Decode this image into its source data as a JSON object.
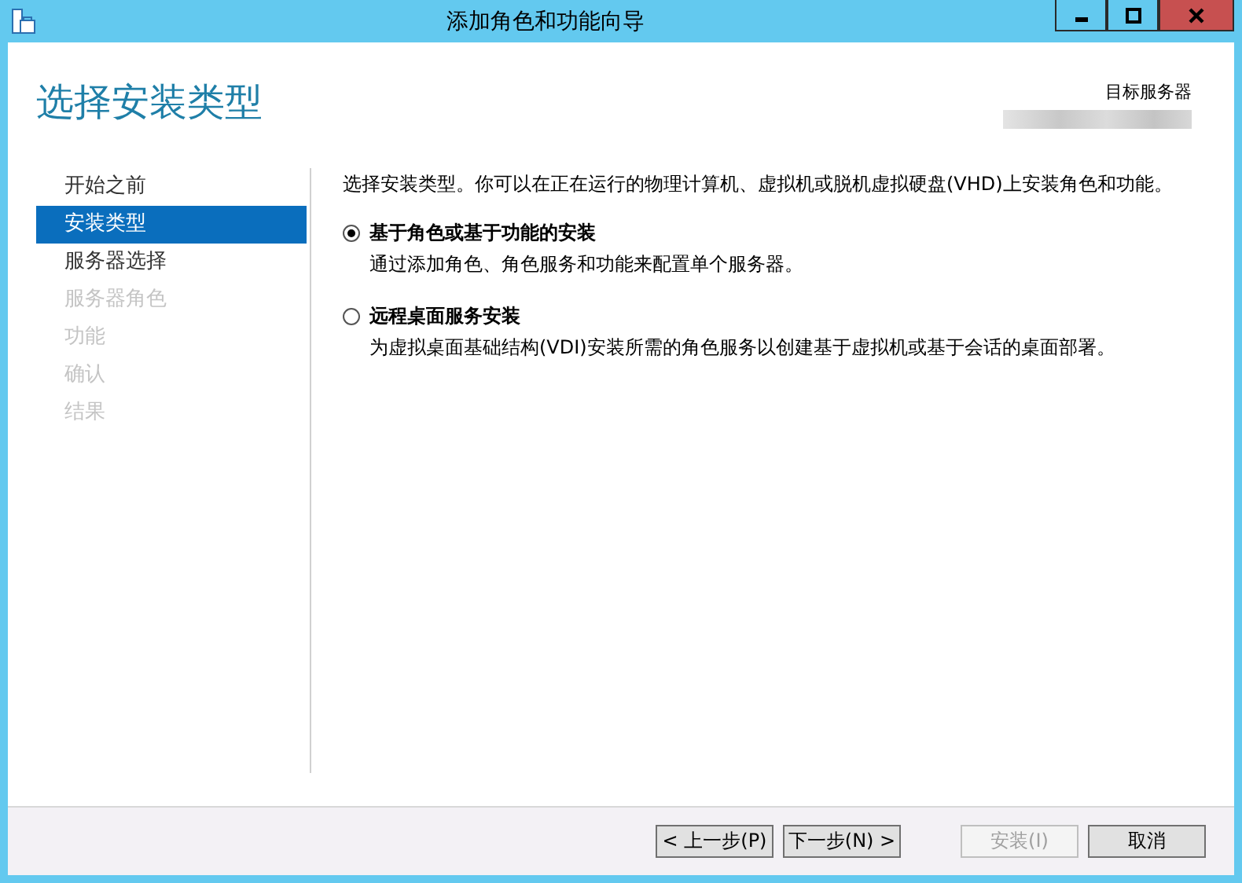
{
  "window": {
    "title": "添加角色和功能向导"
  },
  "header": {
    "title": "选择安装类型",
    "target_label": "目标服务器"
  },
  "nav": [
    {
      "label": "开始之前",
      "selected": false,
      "disabled": false
    },
    {
      "label": "安装类型",
      "selected": true,
      "disabled": false
    },
    {
      "label": "服务器选择",
      "selected": false,
      "disabled": false
    },
    {
      "label": "服务器角色",
      "selected": false,
      "disabled": true
    },
    {
      "label": "功能",
      "selected": false,
      "disabled": true
    },
    {
      "label": "确认",
      "selected": false,
      "disabled": true
    },
    {
      "label": "结果",
      "selected": false,
      "disabled": true
    }
  ],
  "intro": "选择安装类型。你可以在正在运行的物理计算机、虚拟机或脱机虚拟硬盘(VHD)上安装角色和功能。",
  "options": [
    {
      "label": "基于角色或基于功能的安装",
      "description": "通过添加角色、角色服务和功能来配置单个服务器。",
      "selected": true
    },
    {
      "label": "远程桌面服务安装",
      "description": "为虚拟桌面基础结构(VDI)安装所需的角色服务以创建基于虚拟机或基于会话的桌面部署。",
      "selected": false
    }
  ],
  "buttons": [
    {
      "label": "< 上一步(P)",
      "disabled": false
    },
    {
      "label": "下一步(N) >",
      "disabled": false
    },
    {
      "label": "安装(I)",
      "disabled": true
    },
    {
      "label": "取消",
      "disabled": false
    }
  ]
}
